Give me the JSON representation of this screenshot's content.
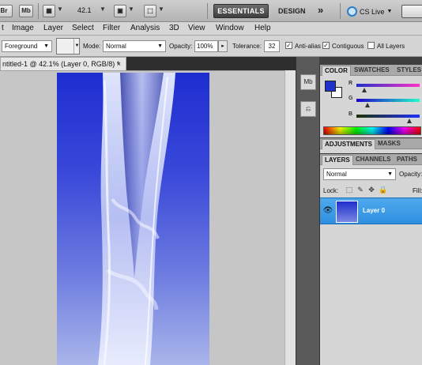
{
  "appbar": {
    "br_label": "Br",
    "mb_label": "Mb",
    "zoom": "42.1",
    "essentials": "ESSENTIALS",
    "design": "DESIGN",
    "more": "»",
    "cs_live": "CS Live"
  },
  "menubar": {
    "items": [
      "t",
      "Image",
      "Layer",
      "Select",
      "Filter",
      "Analysis",
      "3D",
      "View",
      "Window",
      "Help"
    ]
  },
  "options": {
    "fill_source": "Foreground",
    "mode_label": "Mode:",
    "mode_value": "Normal",
    "opacity_label": "Opacity:",
    "opacity_value": "100%",
    "tolerance_label": "Tolerance:",
    "tolerance_value": "32",
    "antialias_label": "Anti-alias",
    "antialias_checked": true,
    "contiguous_label": "Contiguous",
    "contiguous_checked": true,
    "all_layers_label": "All Layers",
    "all_layers_checked": false
  },
  "document": {
    "tab_title": "ntitled-1 @ 42.1% (Layer 0, RGB/8) *",
    "close": "×"
  },
  "color_panel": {
    "tabs": [
      "COLOR",
      "SWATCHES",
      "STYLES"
    ],
    "active_tab": "COLOR",
    "channels": [
      "R",
      "G",
      "B"
    ],
    "foreground_color": "#1f31c9",
    "background_color": "#ffffff"
  },
  "adjust_panel": {
    "tabs": [
      "ADJUSTMENTS",
      "MASKS"
    ],
    "active_tab": "ADJUSTMENTS"
  },
  "layers_panel": {
    "tabs": [
      "LAYERS",
      "CHANNELS",
      "PATHS"
    ],
    "active_tab": "LAYERS",
    "blend_mode": "Normal",
    "opacity_label": "Opacity:",
    "lock_label": "Lock:",
    "fill_label": "Fill:",
    "layers": [
      {
        "name": "Layer 0",
        "visible": true,
        "selected": true
      }
    ]
  }
}
